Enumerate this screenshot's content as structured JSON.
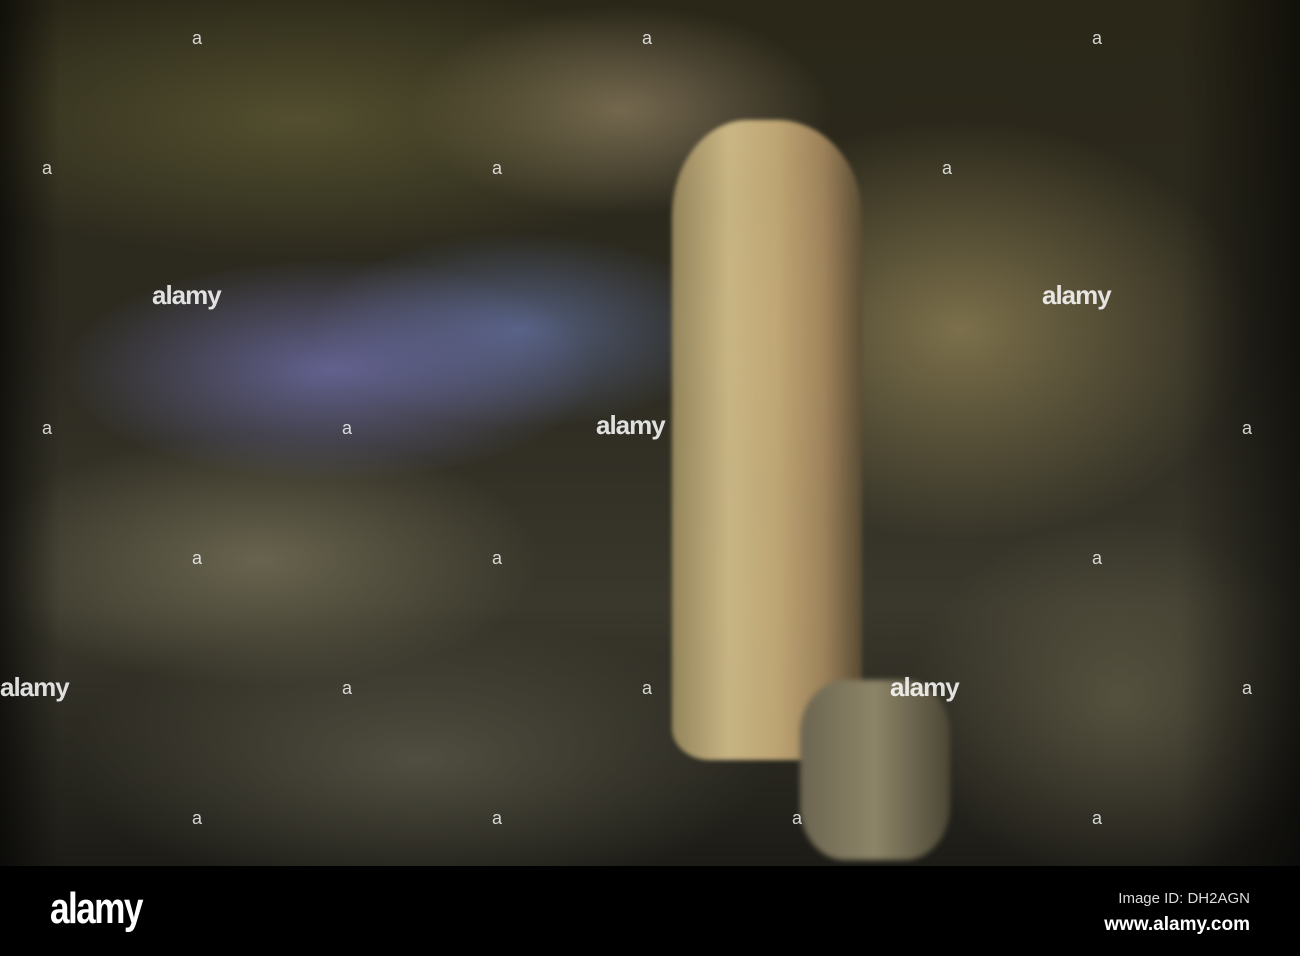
{
  "watermark": {
    "text": "alamy",
    "mark": "a"
  },
  "footer": {
    "logo": "alamy",
    "image_id": "Image ID: DH2AGN",
    "url": "www.alamy.com"
  }
}
